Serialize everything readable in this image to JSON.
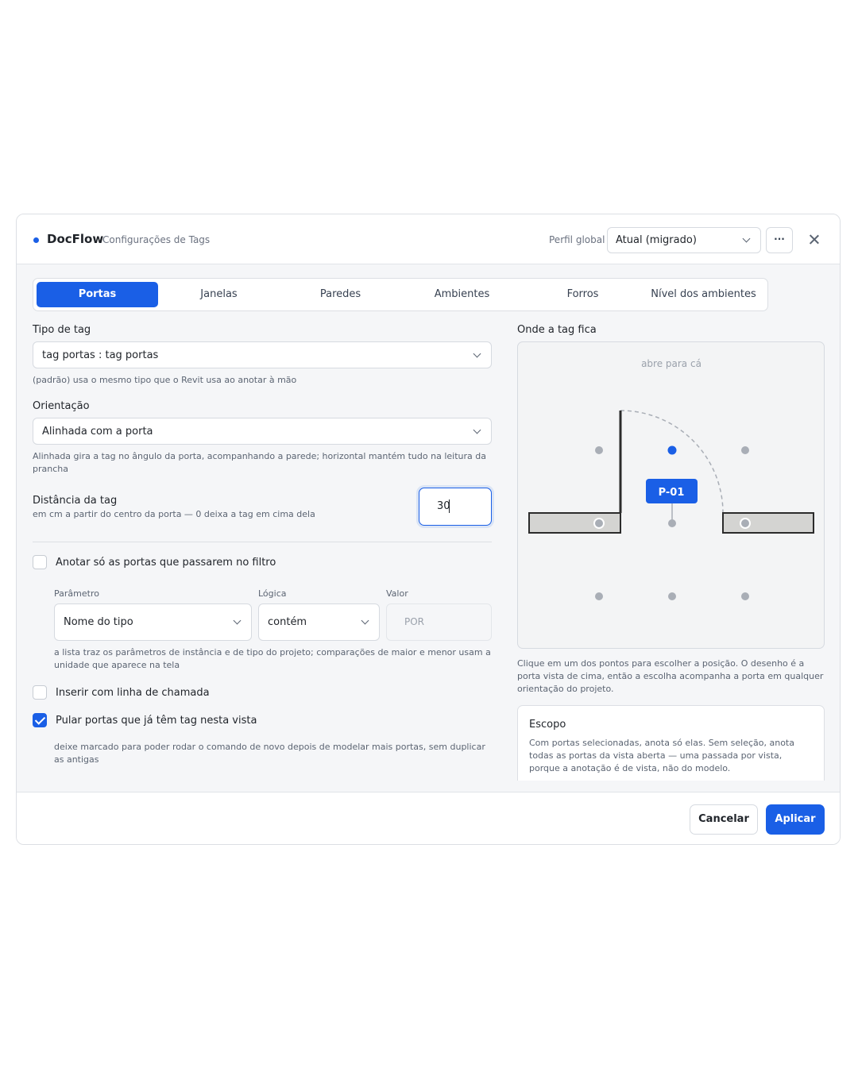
{
  "header": {
    "app_name": "DocFlow",
    "subtitle": "Configurações de Tags",
    "profile_label": "Perfil global",
    "profile_value": "Atual (migrado)",
    "more_label": "···"
  },
  "tabs": [
    {
      "label": "Portas",
      "active": true
    },
    {
      "label": "Janelas",
      "active": false
    },
    {
      "label": "Paredes",
      "active": false
    },
    {
      "label": "Ambientes",
      "active": false
    },
    {
      "label": "Forros",
      "active": false
    },
    {
      "label": "Nível dos ambientes",
      "active": false
    }
  ],
  "form": {
    "tag_type": {
      "label": "Tipo de tag",
      "value": "tag portas : tag portas",
      "help": "(padrão) usa o mesmo tipo que o Revit usa ao anotar à mão"
    },
    "orientation": {
      "label": "Orientação",
      "value": "Alinhada com a porta",
      "help": "Alinhada gira a tag no ângulo da porta, acompanhando a parede; horizontal mantém tudo na leitura da prancha"
    },
    "distance": {
      "label": "Distância da tag",
      "help": "em cm a partir do centro da porta — 0 deixa a tag em cima dela",
      "value": "30"
    },
    "filter": {
      "checkbox_label": "Anotar só as portas que passarem no filtro",
      "checked": false,
      "param_label": "Parâmetro",
      "param_value": "Nome do tipo",
      "logic_label": "Lógica",
      "logic_value": "contém",
      "value_label": "Valor",
      "value_placeholder": "POR",
      "help": "a lista traz os parâmetros de instância e de tipo do projeto; comparações de maior e menor usam a unidade que aparece na tela"
    },
    "leader": {
      "checkbox_label": "Inserir com linha de chamada",
      "checked": false
    },
    "skip": {
      "checkbox_label": "Pular portas que já têm tag nesta vista",
      "checked": true,
      "help": "deixe marcado para poder rodar o comando de novo depois de modelar mais portas, sem duplicar as antigas"
    }
  },
  "placement": {
    "label": "Onde a tag fica",
    "opens_label": "abre para cá",
    "tag_text": "P-01",
    "selected_point": "top-center",
    "help": "Clique em um dos pontos para escolher a posição. O desenho é a porta vista de cima, então a escolha acompanha a porta em qualquer orientação do projeto."
  },
  "scope": {
    "title": "Escopo",
    "text": "Com portas selecionadas, anota só elas. Sem seleção, anota todas as portas da vista aberta — uma passada por vista, porque a anotação é de vista, não do modelo."
  },
  "footer": {
    "cancel_label": "Cancelar",
    "apply_label": "Aplicar"
  },
  "colors": {
    "accent": "#1a5fe6",
    "point_idle": "#a9aeb6",
    "wall_fill": "#d4d4d2"
  }
}
